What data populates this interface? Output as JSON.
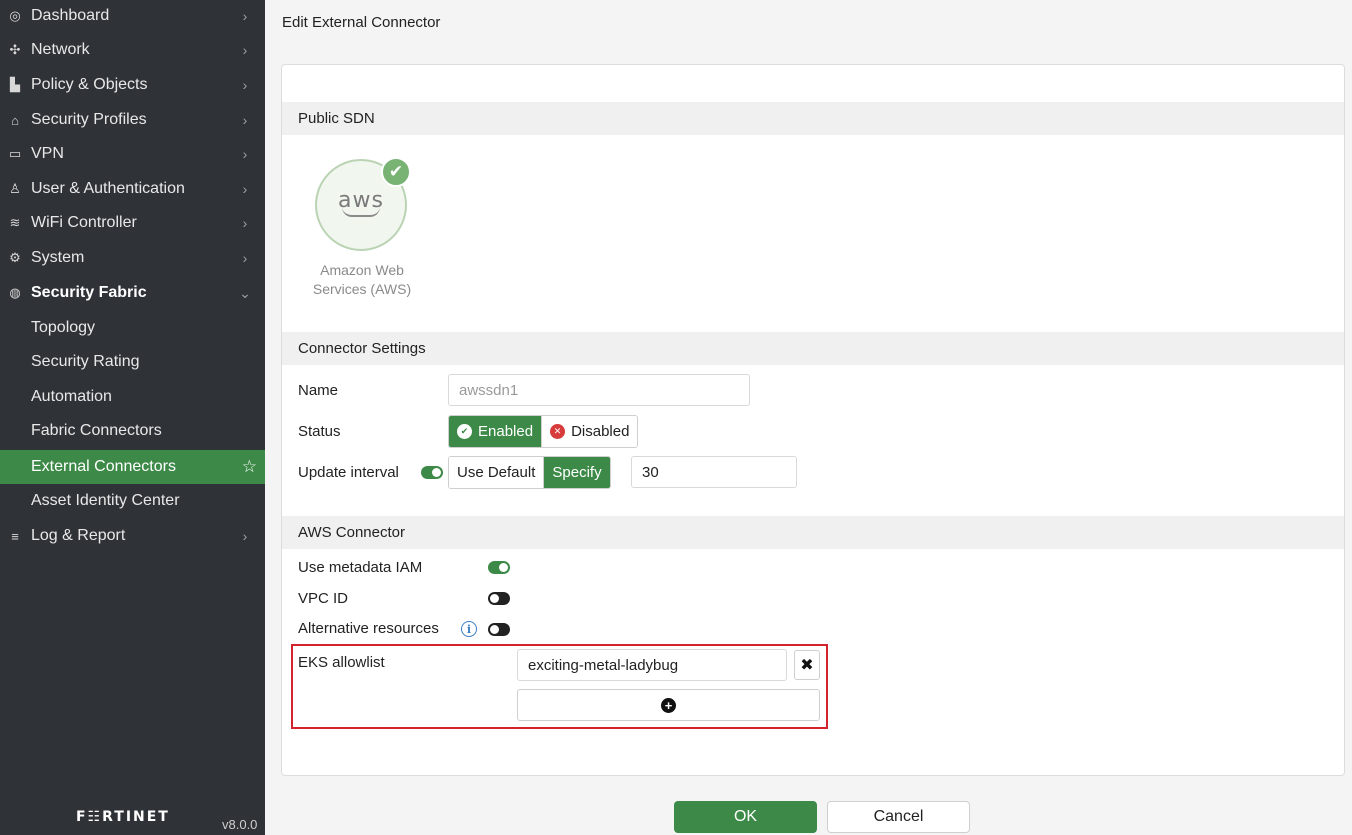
{
  "sidebar": {
    "items": [
      {
        "label": "Dashboard",
        "icon": "dashboard-icon",
        "glyph": "◎"
      },
      {
        "label": "Network",
        "icon": "network-icon",
        "glyph": "✣"
      },
      {
        "label": "Policy & Objects",
        "icon": "policy-icon",
        "glyph": "▙"
      },
      {
        "label": "Security Profiles",
        "icon": "lock-icon",
        "glyph": "⌂"
      },
      {
        "label": "VPN",
        "icon": "laptop-icon",
        "glyph": "▭"
      },
      {
        "label": "User & Authentication",
        "icon": "user-icon",
        "glyph": "♙"
      },
      {
        "label": "WiFi Controller",
        "icon": "wifi-icon",
        "glyph": "≋"
      },
      {
        "label": "System",
        "icon": "gear-icon",
        "glyph": "⚙"
      },
      {
        "label": "Security Fabric",
        "icon": "security-fabric-icon",
        "glyph": "◍"
      }
    ],
    "sub_items": [
      {
        "label": "Topology"
      },
      {
        "label": "Security Rating"
      },
      {
        "label": "Automation"
      },
      {
        "label": "Fabric Connectors"
      },
      {
        "label": "External Connectors"
      },
      {
        "label": "Asset Identity Center"
      }
    ],
    "log_report": {
      "label": "Log & Report",
      "icon": "log-report-icon",
      "glyph": "≡"
    },
    "chevron": "›",
    "chevron_down": "⌄",
    "star": "☆",
    "brand": "F☷RTINET",
    "version": "v8.0.0"
  },
  "page": {
    "title": "Edit External Connector"
  },
  "public_sdn": {
    "header": "Public SDN",
    "card_logo": "aws",
    "card_label_line1": "Amazon Web",
    "card_label_line2": "Services (AWS)",
    "check": "✔"
  },
  "connector_settings": {
    "header": "Connector Settings",
    "name_label": "Name",
    "name_value": "awssdn1",
    "status_label": "Status",
    "status_enabled": "Enabled",
    "status_disabled": "Disabled",
    "status_selected": "Enabled",
    "update_label": "Update interval",
    "update_toggle_on": true,
    "use_default": "Use Default",
    "specify": "Specify",
    "update_selected": "Specify",
    "interval_value": "30"
  },
  "aws_connector": {
    "header": "AWS Connector",
    "metadata_label": "Use metadata IAM",
    "metadata_on": true,
    "vpc_label": "VPC ID",
    "vpc_on": false,
    "alt_label": "Alternative resources",
    "alt_on": false,
    "info_glyph": "i",
    "eks_label": "EKS allowlist",
    "eks_values": [
      "exciting-metal-ladybug"
    ],
    "remove_glyph": "✖",
    "add_glyph": "+"
  },
  "footer": {
    "ok": "OK",
    "cancel": "Cancel"
  },
  "colors": {
    "accent": "#3d8a48",
    "sidebar": "#2f3337",
    "highlight": "#d3232c"
  }
}
